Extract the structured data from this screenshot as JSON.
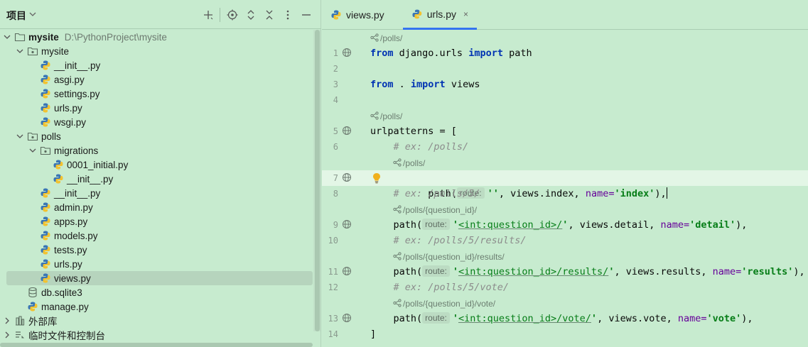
{
  "project_panel": {
    "title": "项目",
    "header_icons": [
      "add-icon",
      "locate-icon",
      "expand-all-icon",
      "collapse-all-icon",
      "more-icon",
      "hide-icon"
    ],
    "tree": [
      {
        "label": "mysite",
        "path": "D:\\PythonProject\\mysite",
        "type": "folder",
        "depth": 0,
        "expanded": true,
        "bold": true
      },
      {
        "label": "mysite",
        "type": "package",
        "depth": 1,
        "expanded": true
      },
      {
        "label": "__init__.py",
        "type": "python",
        "depth": 2
      },
      {
        "label": "asgi.py",
        "type": "python",
        "depth": 2
      },
      {
        "label": "settings.py",
        "type": "python",
        "depth": 2
      },
      {
        "label": "urls.py",
        "type": "python",
        "depth": 2
      },
      {
        "label": "wsgi.py",
        "type": "python",
        "depth": 2
      },
      {
        "label": "polls",
        "type": "package",
        "depth": 1,
        "expanded": true
      },
      {
        "label": "migrations",
        "type": "package",
        "depth": 2,
        "expanded": true
      },
      {
        "label": "0001_initial.py",
        "type": "python",
        "depth": 3
      },
      {
        "label": "__init__.py",
        "type": "python",
        "depth": 3
      },
      {
        "label": "__init__.py",
        "type": "python",
        "depth": 2
      },
      {
        "label": "admin.py",
        "type": "python",
        "depth": 2
      },
      {
        "label": "apps.py",
        "type": "python",
        "depth": 2
      },
      {
        "label": "models.py",
        "type": "python",
        "depth": 2
      },
      {
        "label": "tests.py",
        "type": "python",
        "depth": 2
      },
      {
        "label": "urls.py",
        "type": "python",
        "depth": 2
      },
      {
        "label": "views.py",
        "type": "python",
        "depth": 2,
        "selected": true
      },
      {
        "label": "db.sqlite3",
        "type": "database",
        "depth": 1
      },
      {
        "label": "manage.py",
        "type": "python",
        "depth": 1
      },
      {
        "label": "外部库",
        "type": "library",
        "depth": 0,
        "expanded": false
      },
      {
        "label": "临时文件和控制台",
        "type": "scratches",
        "depth": 0,
        "expanded": false
      }
    ]
  },
  "editor": {
    "tabs": [
      {
        "label": "views.py",
        "active": false
      },
      {
        "label": "urls.py",
        "active": true,
        "close": "×"
      }
    ],
    "hints": {
      "h0": "/polls/",
      "h4": "/polls/",
      "h6": "/polls/",
      "h8": "/polls/{question_id}/",
      "h10": "/polls/{question_id}/results/",
      "h12": "/polls/{question_id}/vote/"
    },
    "line_numbers": [
      "1",
      "2",
      "3",
      "4",
      "5",
      "6",
      "7",
      "8",
      "9",
      "10",
      "11",
      "12",
      "13",
      "14"
    ],
    "code": {
      "l1_kw1": "from",
      "l1_mod": " django.urls ",
      "l1_kw2": "import",
      "l1_name": " path",
      "l3_kw1": "from",
      "l3_mod": " . ",
      "l3_kw2": "import",
      "l3_name": " views",
      "l5": "urlpatterns = [",
      "l6": "    # ex: /polls/",
      "l7_pre": "    path(",
      "l7_hint": "route:",
      "l7_str": "''",
      "l7_mid": ", views.index, ",
      "l7_kw": "name=",
      "l7_val": "'index'",
      "l7_end": "),",
      "l8": "    # ex: /polls/5/",
      "l9_pre": "    path(",
      "l9_hint": "route:",
      "l9_q1": "'",
      "l9_re": "<int:question_id>/",
      "l9_q2": "'",
      "l9_mid": ", views.detail, ",
      "l9_kw": "name=",
      "l9_val": "'detail'",
      "l9_end": "),",
      "l10": "    # ex: /polls/5/results/",
      "l11_pre": "    path(",
      "l11_hint": "route:",
      "l11_q1": "'",
      "l11_re": "<int:question_id>/results/",
      "l11_q2": "'",
      "l11_mid": ", views.results, ",
      "l11_kw": "name=",
      "l11_val": "'results'",
      "l11_end": "),",
      "l12": "    # ex: /polls/5/vote/",
      "l13_pre": "    path(",
      "l13_hint": "route:",
      "l13_q1": "'",
      "l13_re": "<int:question_id>/vote/",
      "l13_q2": "'",
      "l13_mid": ", views.vote, ",
      "l13_kw": "name=",
      "l13_val": "'vote'",
      "l13_end": "),",
      "l14": "]"
    }
  },
  "colors": {
    "background": "#c7ebcf",
    "keyword": "#0033b3",
    "string": "#067d17",
    "comment": "#8c8c8c",
    "kwarg": "#660099",
    "accent": "#3574f0"
  }
}
